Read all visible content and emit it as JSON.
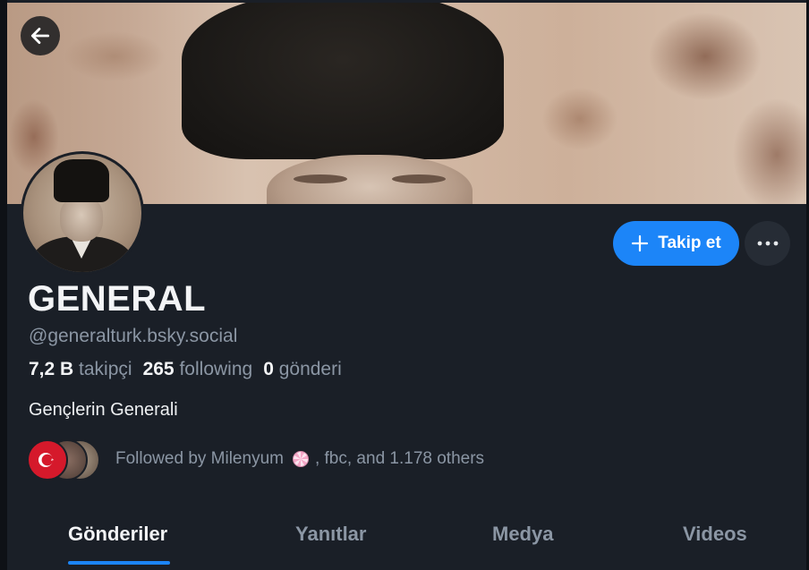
{
  "profile": {
    "display_name": "GENERAL",
    "handle": "@generalturk.bsky.social",
    "bio": "Gençlerin Generali"
  },
  "stats": {
    "followers_count": "7,2 B",
    "followers_label": "takipçi",
    "following_count": "265",
    "following_label": "following",
    "posts_count": "0",
    "posts_label": "gönderi"
  },
  "actions": {
    "follow_label": "Takip et",
    "follow_color": "#1c85f8"
  },
  "followed_by": {
    "prefix": "Followed by Milenyum",
    "suffix": ", fbc, and 1.178 others"
  },
  "tabs": [
    {
      "label": "Gönderiler",
      "active": true
    },
    {
      "label": "Yanıtlar",
      "active": false
    },
    {
      "label": "Medya",
      "active": false
    },
    {
      "label": "Videos",
      "active": false
    }
  ],
  "icons": {
    "back": "arrow-left-icon",
    "follow": "plus-icon",
    "more": "ellipsis-icon",
    "candy": "candy-icon"
  }
}
